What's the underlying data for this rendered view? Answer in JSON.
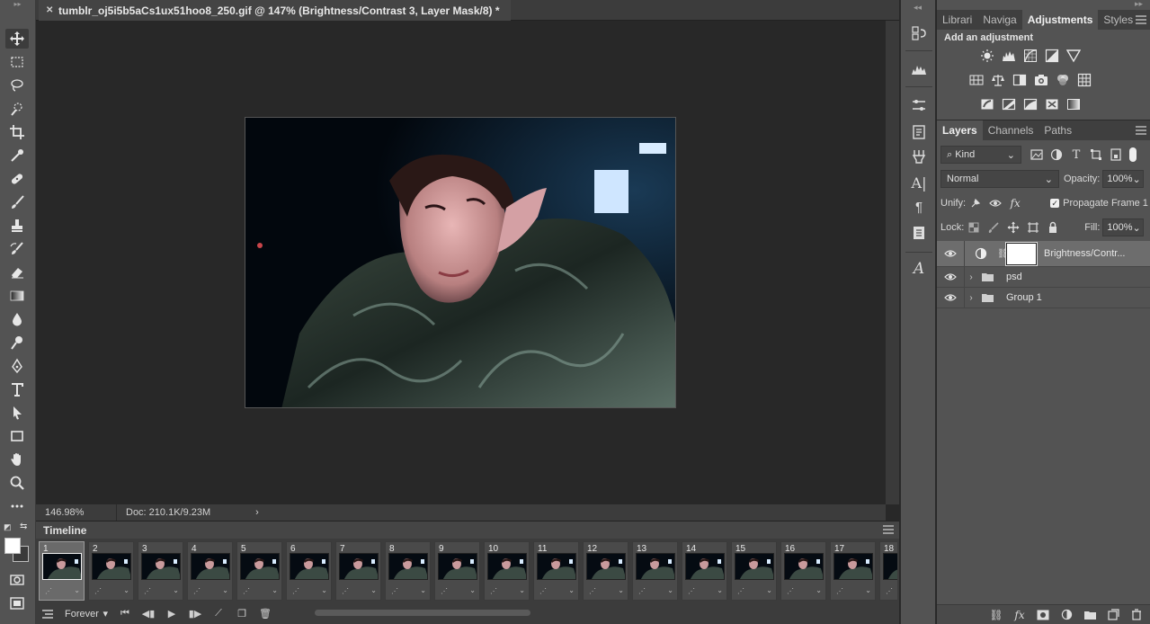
{
  "document": {
    "tab_title": "tumblr_oj5i5b5aCs1ux51hoo8_250.gif @ 147% (Brightness/Contrast 3, Layer Mask/8) *",
    "zoom": "146.98%",
    "doc_info": "Doc: 210.1K/9.23M"
  },
  "timeline": {
    "title": "Timeline",
    "loop": "Forever",
    "frames": [
      "1",
      "2",
      "3",
      "4",
      "5",
      "6",
      "7",
      "8",
      "9",
      "10",
      "11",
      "12",
      "13",
      "14",
      "15",
      "16",
      "17",
      "18"
    ],
    "selected_frame": "1"
  },
  "adjustments_panel": {
    "tabs": [
      "Librari",
      "Naviga",
      "Adjustments",
      "Styles"
    ],
    "active_tab": "Adjustments",
    "title": "Add an adjustment"
  },
  "layers_panel": {
    "tabs": [
      "Layers",
      "Channels",
      "Paths"
    ],
    "active_tab": "Layers",
    "filter_kind": "Kind",
    "blend_mode": "Normal",
    "opacity_label": "Opacity:",
    "opacity_value": "100%",
    "unify_label": "Unify:",
    "propagate_label": "Propagate Frame 1",
    "lock_label": "Lock:",
    "fill_label": "Fill:",
    "fill_value": "100%",
    "layers": [
      {
        "name": "Brightness/Contr...",
        "type": "adjustment",
        "selected": true
      },
      {
        "name": "psd",
        "type": "group"
      },
      {
        "name": "Group 1",
        "type": "group"
      }
    ]
  },
  "colors": {
    "panel_bg": "#535353",
    "canvas_bg": "#282828",
    "selected_layer": "#6d6d6d"
  }
}
